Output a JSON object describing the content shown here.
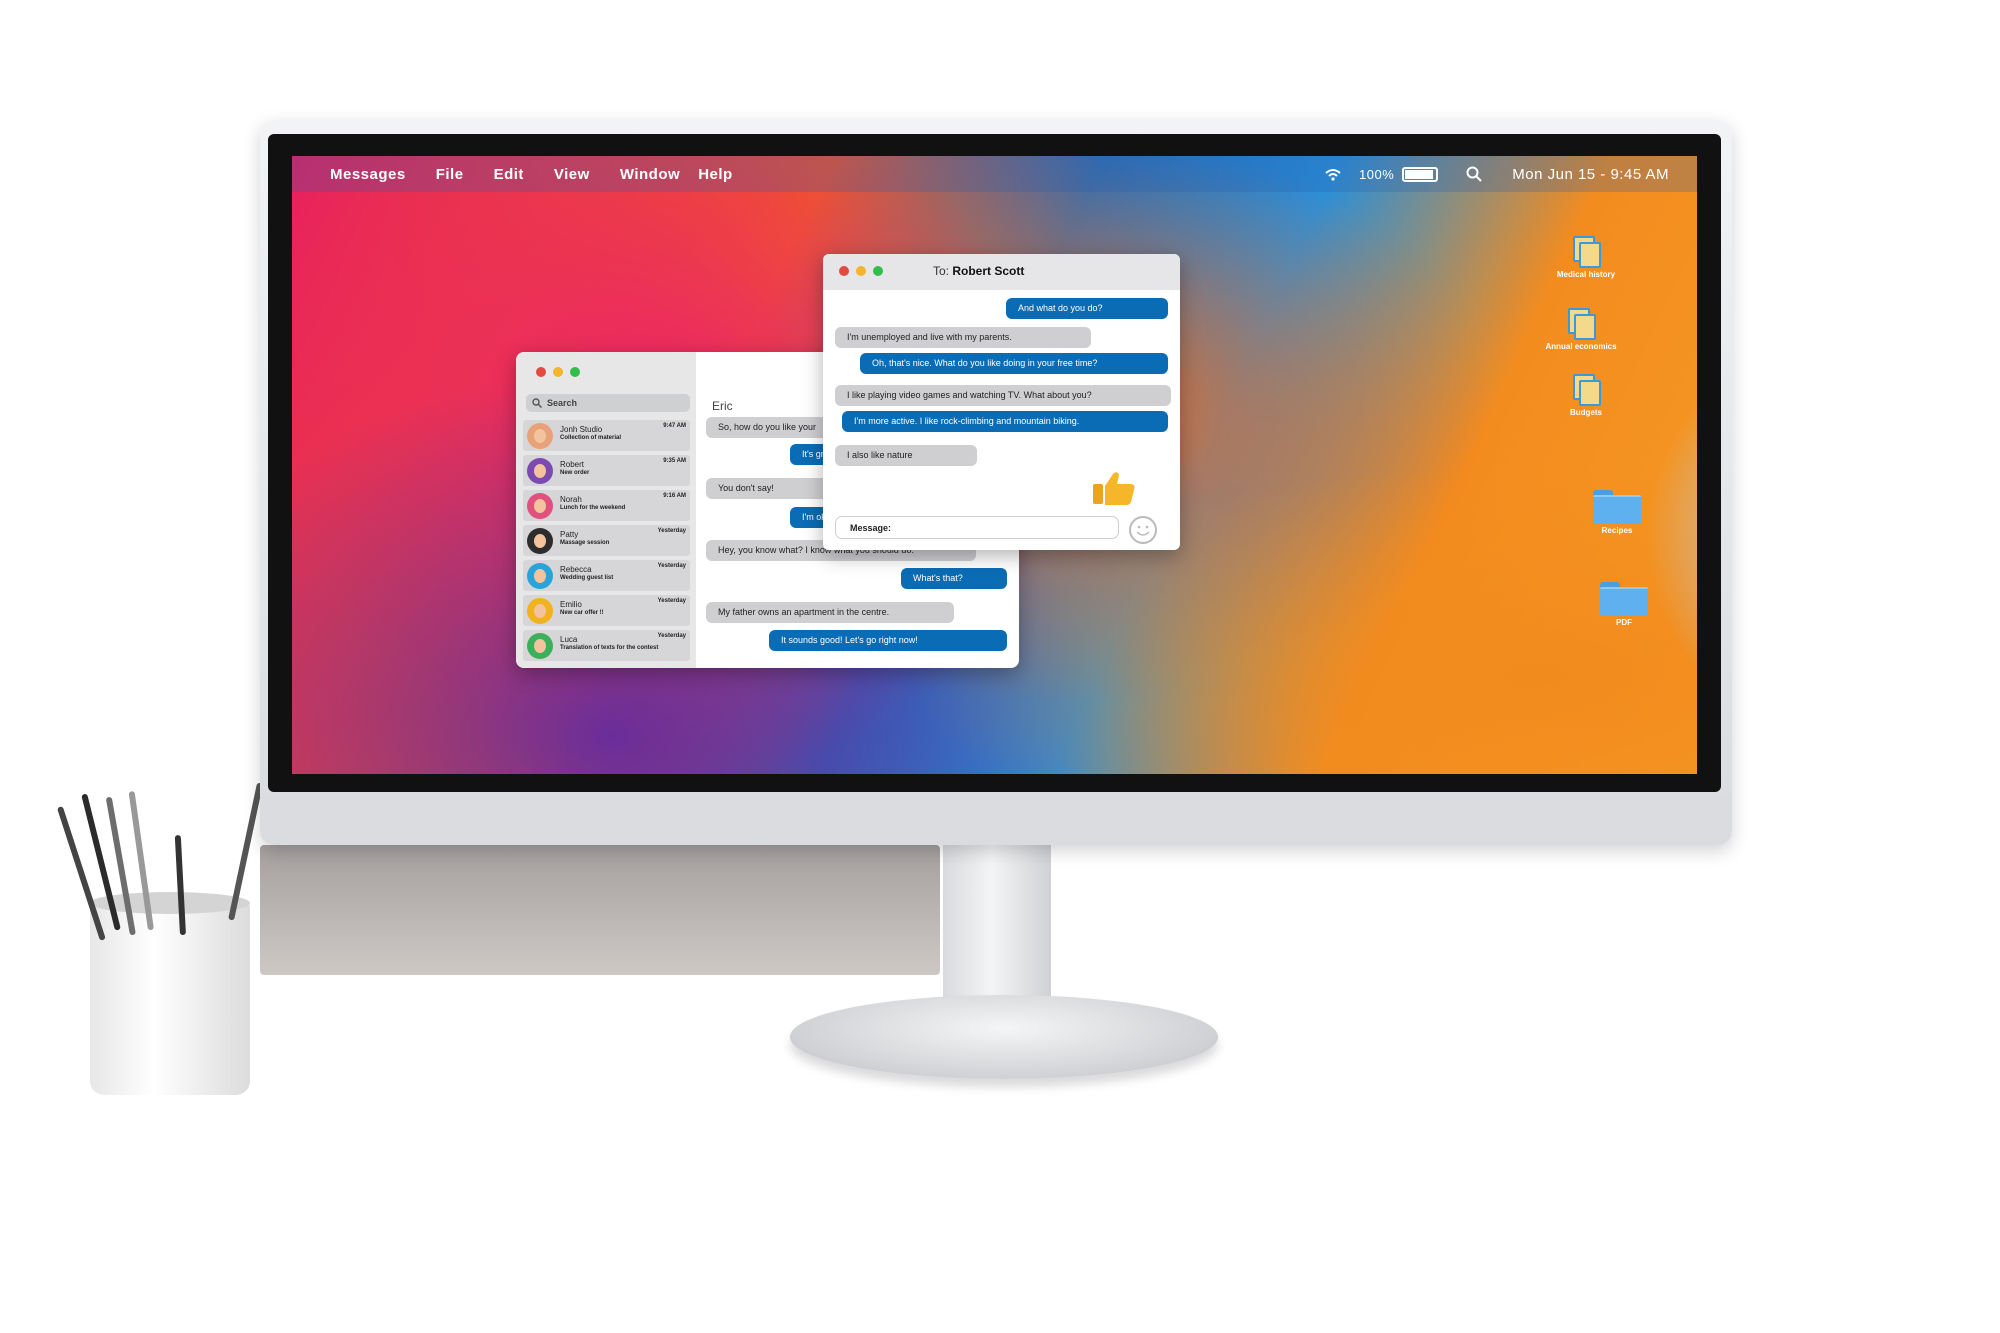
{
  "menubar": {
    "app": "Messages",
    "items": [
      "File",
      "Edit",
      "View",
      "Window",
      "Help"
    ],
    "battery": "100%",
    "battery_fraction": 1.0,
    "datetime": "Mon Jun 15 - 9:45 AM"
  },
  "desktop_icons": [
    {
      "label": "Medical history",
      "icon": "document-icon"
    },
    {
      "label": "Annual economics",
      "icon": "document-icon"
    },
    {
      "label": "Budgets",
      "icon": "document-icon"
    },
    {
      "label": "Recipes",
      "icon": "folder-icon"
    },
    {
      "label": "PDF",
      "icon": "folder-icon"
    }
  ],
  "messages_window": {
    "search_placeholder": "Search",
    "contacts": [
      {
        "name": "Jonh Studio",
        "subtitle": "Collection of material",
        "time": "9:47 AM"
      },
      {
        "name": "Robert",
        "subtitle": "New order",
        "time": "9:35 AM"
      },
      {
        "name": "Norah",
        "subtitle": "Lunch for the weekend",
        "time": "9:16 AM"
      },
      {
        "name": "Patty",
        "subtitle": "Massage session",
        "time": "Yesterday"
      },
      {
        "name": "Rebecca",
        "subtitle": "Wedding guest list",
        "time": "Yesterday"
      },
      {
        "name": "Emilio",
        "subtitle": "New car offer !!",
        "time": "Yesterday"
      },
      {
        "name": "Luca",
        "subtitle": "Translation of texts for the contest",
        "time": "Yesterday"
      }
    ],
    "conversation_name": "Eric",
    "messages": [
      {
        "dir": "in",
        "text": "So, how do you like your"
      },
      {
        "dir": "out",
        "text": "It's gr"
      },
      {
        "dir": "in",
        "text": "You don't say!"
      },
      {
        "dir": "out",
        "text": "I'm ok"
      },
      {
        "dir": "in",
        "text": "Hey, you know what? I know what you should do."
      },
      {
        "dir": "out",
        "text": "What's that?"
      },
      {
        "dir": "in",
        "text": "My father owns an apartment in the centre."
      },
      {
        "dir": "out",
        "text": "It sounds good! Let's go right now!"
      }
    ]
  },
  "chat_window": {
    "to_label": "To:",
    "recipient": "Robert Scott",
    "messages": [
      {
        "dir": "out",
        "text": "And what do you do?"
      },
      {
        "dir": "in",
        "text": "I'm unemployed and live with my parents."
      },
      {
        "dir": "out",
        "text": "Oh, that's nice. What do you like doing in your free time?"
      },
      {
        "dir": "in",
        "text": "I like playing video games and watching TV. What about you?"
      },
      {
        "dir": "out",
        "text": "I'm more active. I like rock-climbing and mountain biking."
      },
      {
        "dir": "in",
        "text": "I also like nature"
      }
    ],
    "reaction_icon": "thumbs-up-icon",
    "message_label": "Message:"
  },
  "colors": {
    "bubble_out": "#0a6cb5",
    "bubble_in": "#cfcfd1",
    "traffic_red": "#e24a3f",
    "traffic_yellow": "#f2b52b",
    "traffic_green": "#2fbf4a"
  }
}
